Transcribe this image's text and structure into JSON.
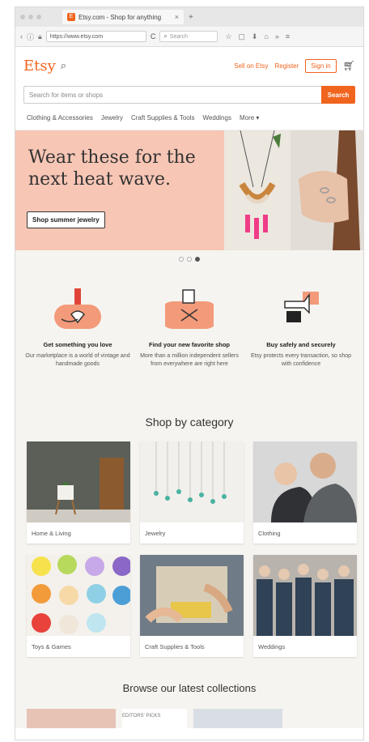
{
  "browser": {
    "tab_title": "Etsy.com - Shop for anything",
    "url": "https://www.etsy.com",
    "search_placeholder": "Search"
  },
  "header": {
    "logo": "Etsy",
    "sell": "Sell on Etsy",
    "register": "Register",
    "sign_in": "Sign in"
  },
  "search": {
    "placeholder": "Search for items or shops",
    "button": "Search"
  },
  "categories_nav": [
    "Clothing & Accessories",
    "Jewelry",
    "Craft Supplies & Tools",
    "Weddings",
    "More ▾"
  ],
  "hero": {
    "title": "Wear these for the next heat wave.",
    "button": "Shop summer jewelry"
  },
  "value_props": [
    {
      "title": "Get something you love",
      "desc": "Our marketplace is a world of vintage and handmade goods"
    },
    {
      "title": "Find your new favorite shop",
      "desc": "More than a million independent sellers from everywhere are right here"
    },
    {
      "title": "Buy safely and securely",
      "desc": "Etsy protects every transaction, so shop with confidence"
    }
  ],
  "shop_by_category": {
    "title": "Shop by category",
    "items": [
      "Home & Living",
      "Jewelry",
      "Clothing",
      "Toys & Games",
      "Craft Supplies & Tools",
      "Weddings"
    ]
  },
  "browse_title": "Browse our latest collections",
  "bottom_label": "EDITORS' PICKS",
  "colors": {
    "accent": "#f1641e",
    "hero_bg": "#f8c6b5",
    "page_bg": "#f5f4f0"
  }
}
